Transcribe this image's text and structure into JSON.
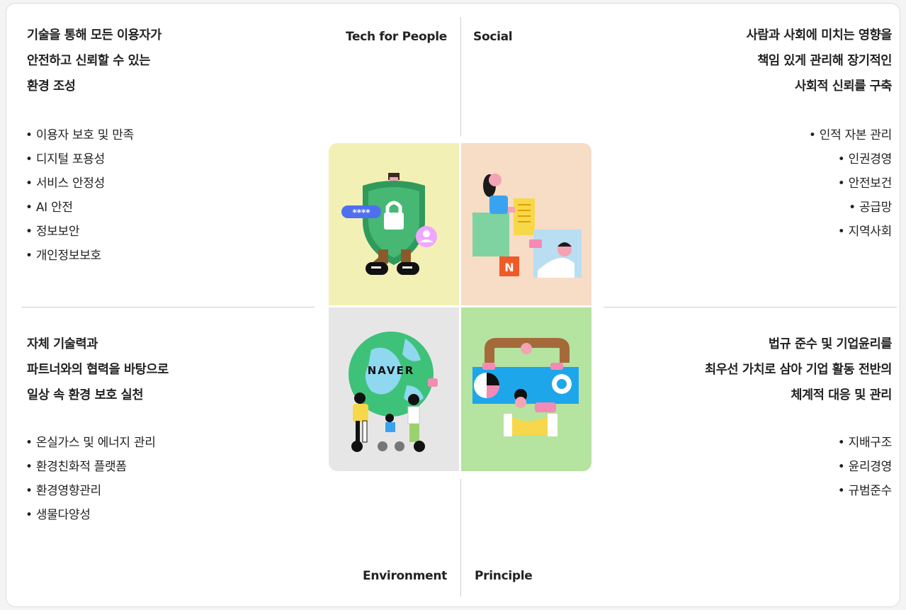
{
  "labels": {
    "tech_for_people": "Tech for People",
    "social": "Social",
    "environment": "Environment",
    "principle": "Principle"
  },
  "tech_for_people": {
    "heading": [
      "기술을 통해 모든 이용자가",
      "안전하고 신뢰할 수 있는",
      "환경 조성"
    ],
    "items": [
      "이용자 보호 및 만족",
      "디지털 포용성",
      "서비스 안정성",
      "AI 안전",
      "정보보안",
      "개인정보보호"
    ],
    "password_text": "****"
  },
  "social": {
    "heading": [
      "사람과 사회에 미치는 영향을",
      "책임 있게 관리해 장기적인",
      "사회적 신뢰를 구축"
    ],
    "items": [
      "인적 자본 관리",
      "인권경영",
      "안전보건",
      "공급망",
      "지역사회"
    ],
    "logo_letter": "N"
  },
  "environment": {
    "heading": [
      "자체 기술력과",
      "파트너와의 협력을 바탕으로",
      "일상 속 환경 보호 실천"
    ],
    "items": [
      "온실가스 및 에너지 관리",
      "환경친화적 플랫폼",
      "환경영향관리",
      "생물다양성"
    ],
    "globe_text": "NAVER"
  },
  "principle": {
    "heading": [
      "법규 준수 및 기업윤리를",
      "최우선 가치로 삼아 기업 활동 전반의",
      "체계적 대응 및 관리"
    ],
    "items": [
      "지배구조",
      "윤리경영",
      "규범준수"
    ]
  },
  "colors": {
    "tl_bg": "#f3f0b5",
    "tr_bg": "#f7dcc6",
    "bl_bg": "#e7e6e7",
    "br_bg": "#b5e3a0",
    "shield_green": "#2f9a5b",
    "naver_green": "#03c75a",
    "accent_orange": "#f05a28",
    "blue": "#3aa3f0"
  }
}
